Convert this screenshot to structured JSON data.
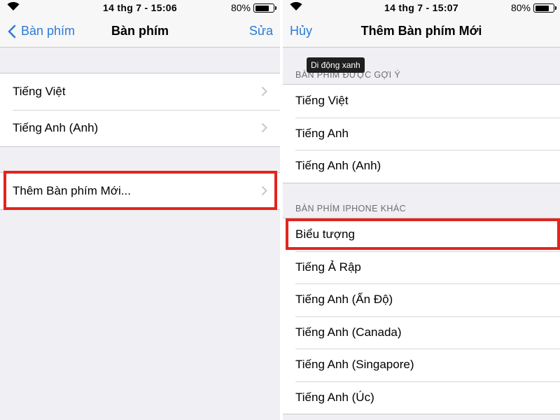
{
  "left": {
    "status": {
      "time": "14 thg 7 - 15:06",
      "battery": "80%",
      "battery_level": 0.8
    },
    "nav": {
      "back_label": "Bàn phím",
      "title": "Bàn phím",
      "edit_label": "Sửa"
    },
    "keyboards": [
      {
        "label": "Tiếng Việt"
      },
      {
        "label": "Tiếng Anh (Anh)"
      }
    ],
    "add_keyboard_label": "Thêm Bàn phím Mới..."
  },
  "right": {
    "status": {
      "time": "14 thg 7 - 15:07",
      "battery": "80%",
      "battery_level": 0.8
    },
    "nav": {
      "cancel_label": "Hủy",
      "title": "Thêm Bàn phím Mới"
    },
    "tooltip": "Di động xanh",
    "suggested_header": "BÀN PHÍM ĐƯỢC GỢI Ý",
    "suggested": [
      {
        "label": "Tiếng Việt"
      },
      {
        "label": "Tiếng Anh"
      },
      {
        "label": "Tiếng Anh (Anh)"
      }
    ],
    "other_header": "BÀN PHÍM IPHONE KHÁC",
    "other": [
      {
        "label": "Biểu tượng"
      },
      {
        "label": "Tiếng Ả Rập"
      },
      {
        "label": "Tiếng Anh (Ấn Độ)"
      },
      {
        "label": "Tiếng Anh (Canada)"
      },
      {
        "label": "Tiếng Anh (Singapore)"
      },
      {
        "label": "Tiếng Anh (Úc)"
      }
    ]
  },
  "colors": {
    "accent": "#2b7bd6",
    "highlight": "#e1261c",
    "background": "#efeff4"
  }
}
